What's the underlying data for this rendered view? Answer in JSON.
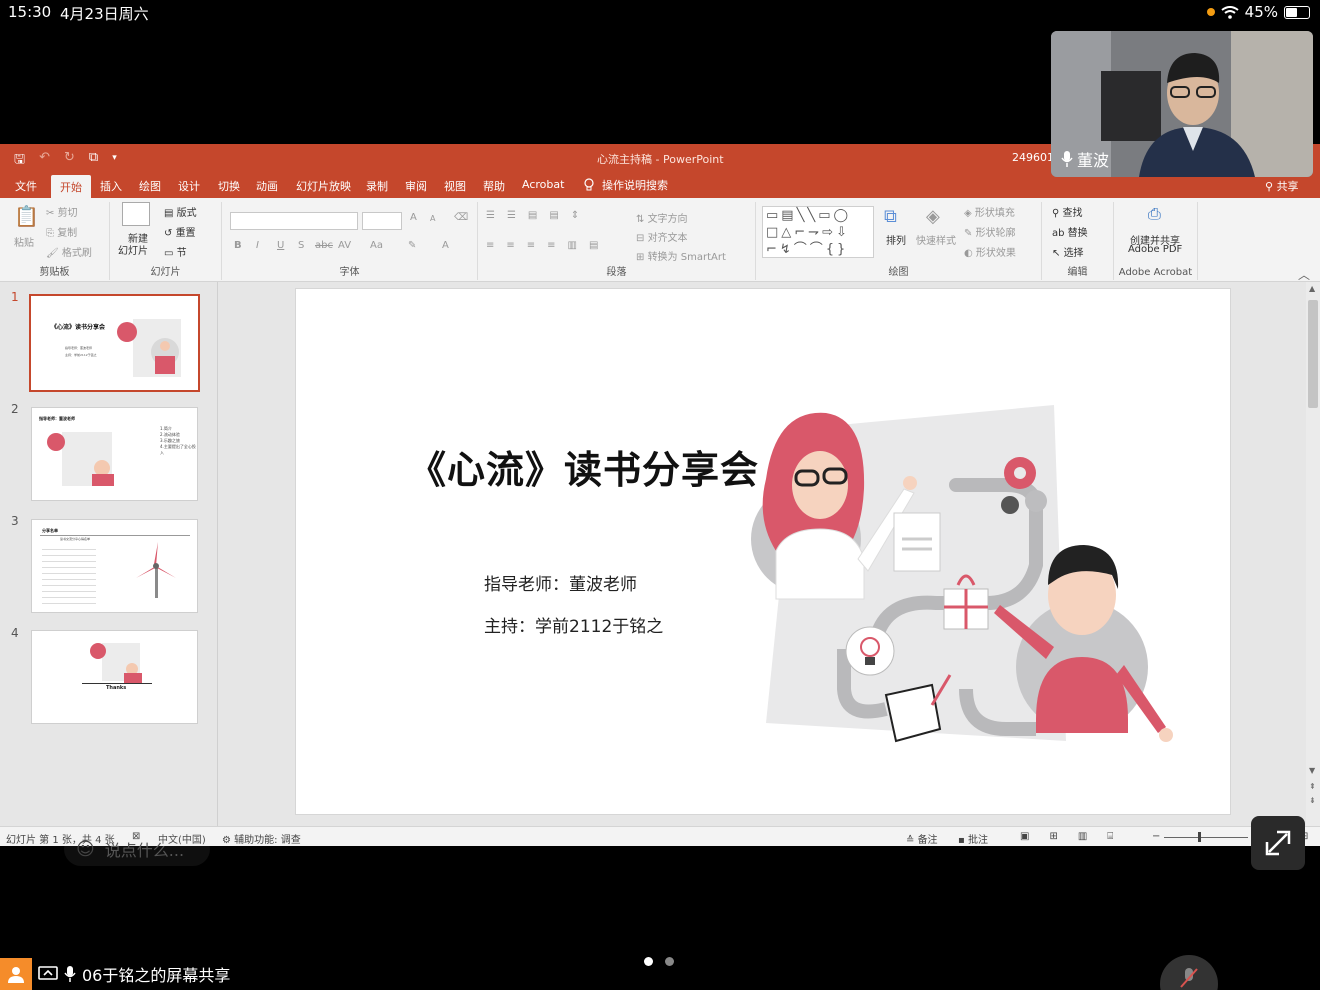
{
  "status": {
    "time": "15:30",
    "date": "4月23日周六",
    "battery": "45%"
  },
  "titlebar": {
    "document": "心流主持稿",
    "separator": "-",
    "app": "PowerPoint",
    "user_id": "249601"
  },
  "menu": {
    "tabs": [
      "文件",
      "开始",
      "插入",
      "绘图",
      "设计",
      "切换",
      "动画",
      "幻灯片放映",
      "录制",
      "审阅",
      "视图",
      "帮助",
      "Acrobat"
    ],
    "active": "开始",
    "search": "操作说明搜索",
    "share": "共享"
  },
  "ribbon": {
    "clipboard": {
      "paste": "粘贴",
      "cut": "剪切",
      "copy": "复制",
      "format_painter": "格式刷",
      "label": "剪贴板"
    },
    "slides": {
      "new_slide_1": "新建",
      "new_slide_2": "幻灯片",
      "layout": "版式",
      "reset": "重置",
      "section": "节",
      "label": "幻灯片"
    },
    "font": {
      "label": "字体",
      "bold": "B",
      "italic": "I",
      "underline": "U",
      "shadow": "S",
      "strike": "abc",
      "spacing": "AV",
      "case": "Aa",
      "grow": "A",
      "shrink": "A",
      "color": "A"
    },
    "paragraph": {
      "label": "段落",
      "text_direction": "文字方向",
      "align_text": "对齐文本",
      "smartart": "转换为 SmartArt"
    },
    "drawing": {
      "label": "绘图",
      "arrange": "排列",
      "quick_styles": "快速样式",
      "fill": "形状填充",
      "outline": "形状轮廓",
      "effects": "形状效果"
    },
    "editing": {
      "label": "编辑",
      "find": "查找",
      "replace": "替换",
      "select": "选择"
    },
    "acrobat": {
      "create_1": "创建并共享",
      "create_2": "Adobe PDF",
      "label": "Adobe Acrobat"
    }
  },
  "thumbnails": [
    {
      "num": "1",
      "title": "《心流》读书分享会",
      "line1": "指导老师：董波老师",
      "line2": "主持：学前2112于铭之"
    },
    {
      "num": "2",
      "title": "指导老师：董波老师",
      "bullets": [
        "1.简介",
        "2.流动体验",
        "3.乐趣之旅",
        "4.主要提出了全心投入"
      ]
    },
    {
      "num": "3",
      "title": "分享名单",
      "subtitle": "读书交流分享心得名单"
    },
    {
      "num": "4",
      "caption": "Thanks"
    }
  ],
  "slide": {
    "title": "《心流》读书分享会",
    "advisor": "指导老师：董波老师",
    "host": "主持：学前2112于铭之"
  },
  "statusbar": {
    "slide_info": "幻灯片 第 1 张，共 4 张",
    "language": "中文(中国)",
    "accessibility": "辅助功能: 调查",
    "notes": "备注",
    "comments": "批注"
  },
  "meeting": {
    "speaker": "董波",
    "chat_placeholder": "说点什么...",
    "share_label": "06于铭之的屏幕共享"
  },
  "colors": {
    "ppt_accent": "#c5472c",
    "illustration_pink": "#d9586a"
  }
}
